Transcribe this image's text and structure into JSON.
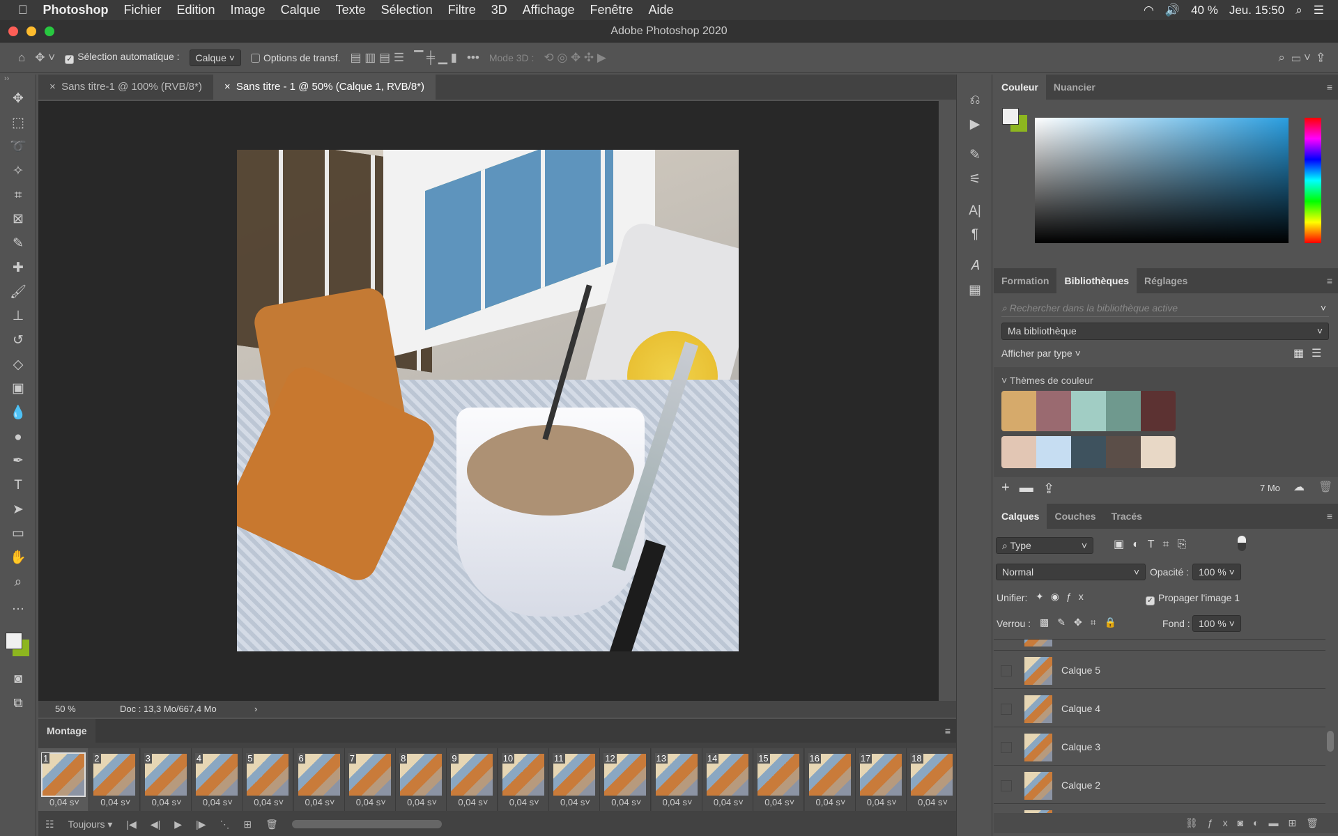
{
  "menubar": {
    "app": "Photoshop",
    "items": [
      "Fichier",
      "Edition",
      "Image",
      "Calque",
      "Texte",
      "Sélection",
      "Filtre",
      "3D",
      "Affichage",
      "Fenêtre",
      "Aide"
    ],
    "battery": "40 %",
    "clock": "Jeu. 15:50"
  },
  "window": {
    "title": "Adobe Photoshop 2020"
  },
  "options": {
    "auto_select_label": "Sélection automatique :",
    "auto_select_value": "Calque",
    "transform_label": "Options de transf.",
    "mode3d": "Mode 3D :"
  },
  "tabs": [
    {
      "label": "Sans titre-1 @ 100% (RVB/8*)"
    },
    {
      "label": "Sans titre - 1 @ 50% (Calque 1, RVB/8*)"
    }
  ],
  "status": {
    "zoom": "50 %",
    "doc": "Doc : 13,3 Mo/667,4 Mo"
  },
  "montage": {
    "title": "Montage",
    "loop": "Toujours",
    "frames": [
      {
        "n": "1",
        "d": "0,04 s"
      },
      {
        "n": "2",
        "d": "0,04 s"
      },
      {
        "n": "3",
        "d": "0,04 s"
      },
      {
        "n": "4",
        "d": "0,04 s"
      },
      {
        "n": "5",
        "d": "0,04 s"
      },
      {
        "n": "6",
        "d": "0,04 s"
      },
      {
        "n": "7",
        "d": "0,04 s"
      },
      {
        "n": "8",
        "d": "0,04 s"
      },
      {
        "n": "9",
        "d": "0,04 s"
      },
      {
        "n": "10",
        "d": "0,04 s"
      },
      {
        "n": "11",
        "d": "0,04 s"
      },
      {
        "n": "12",
        "d": "0,04 s"
      },
      {
        "n": "13",
        "d": "0,04 s"
      },
      {
        "n": "14",
        "d": "0,04 s"
      },
      {
        "n": "15",
        "d": "0,04 s"
      },
      {
        "n": "16",
        "d": "0,04 s"
      },
      {
        "n": "17",
        "d": "0,04 s"
      },
      {
        "n": "18",
        "d": "0,04 s"
      }
    ]
  },
  "color_panel": {
    "tabs": [
      "Couleur",
      "Nuancier"
    ],
    "foreground": "#f0f0f0",
    "background": "#8db61f"
  },
  "libraries": {
    "tabs": [
      "Formation",
      "Bibliothèques",
      "Réglages"
    ],
    "search_placeholder": "Rechercher dans la bibliothèque active",
    "library": "Ma bibliothèque",
    "view_by": "Afficher par type",
    "section": "Thèmes de couleur",
    "themes": [
      [
        "#d6aa6b",
        "#9a6a70",
        "#a1cdc4",
        "#6f998e",
        "#5c3232"
      ],
      [
        "#e2c6b4",
        "#c6ddf2",
        "#3e525e",
        "#5b4e48",
        "#e8d8c6"
      ]
    ],
    "storage": "7 Mo"
  },
  "layers": {
    "tabs": [
      "Calques",
      "Couches",
      "Tracés"
    ],
    "filter": "Type",
    "blend": "Normal",
    "opacity_label": "Opacité :",
    "opacity": "100 %",
    "unify_label": "Unifier:",
    "propagate": "Propager l'image 1",
    "lock_label": "Verrou :",
    "fill_label": "Fond :",
    "fill": "100 %",
    "items": [
      {
        "name": "Calque 5"
      },
      {
        "name": "Calque 4"
      },
      {
        "name": "Calque 3"
      },
      {
        "name": "Calque 2"
      }
    ]
  }
}
